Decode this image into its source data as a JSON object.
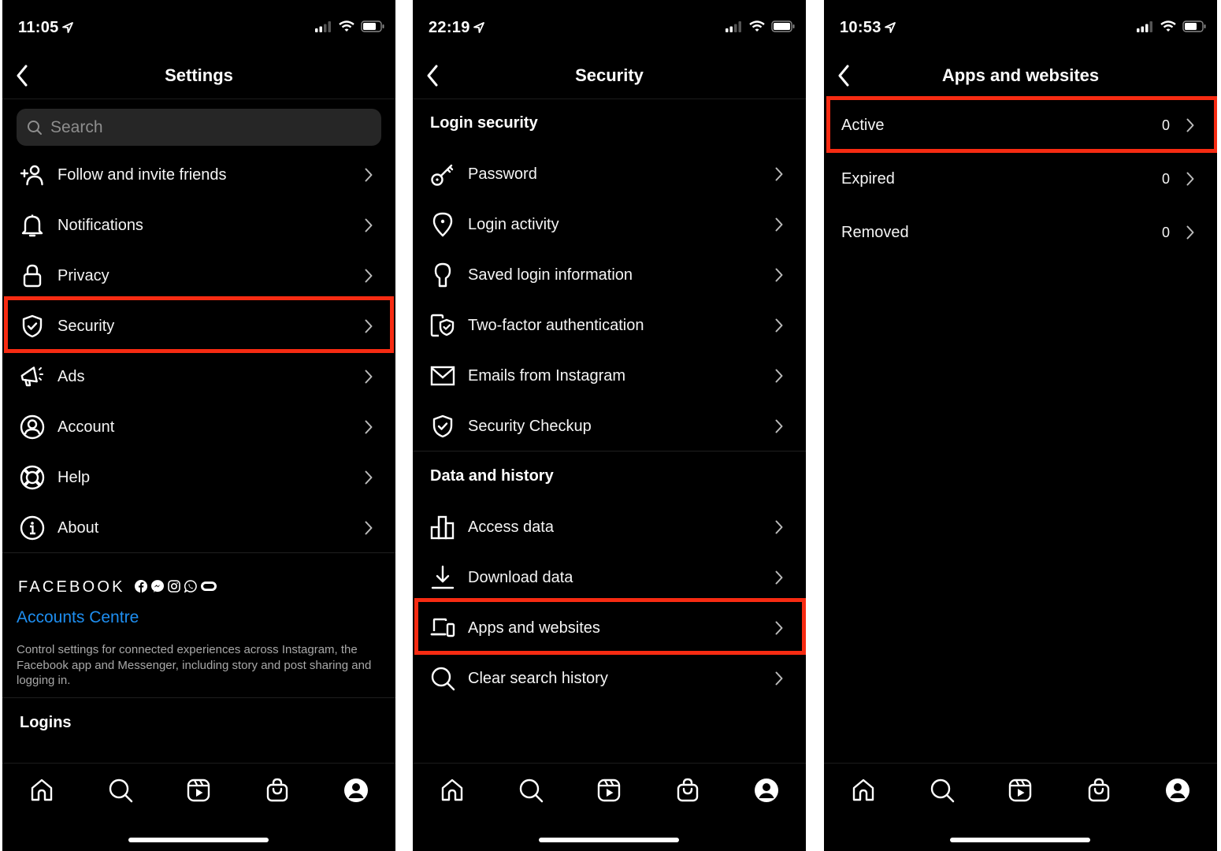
{
  "panels": [
    {
      "status": {
        "time": "11:05"
      },
      "title": "Settings",
      "search": {
        "placeholder": "Search"
      },
      "items": [
        {
          "label": "Follow and invite friends",
          "icon": "add-person-icon"
        },
        {
          "label": "Notifications",
          "icon": "bell-icon"
        },
        {
          "label": "Privacy",
          "icon": "lock-icon"
        },
        {
          "label": "Security",
          "icon": "shield-check-icon",
          "highlighted": true
        },
        {
          "label": "Ads",
          "icon": "megaphone-icon"
        },
        {
          "label": "Account",
          "icon": "account-circle-icon"
        },
        {
          "label": "Help",
          "icon": "lifebuoy-icon"
        },
        {
          "label": "About",
          "icon": "info-icon"
        }
      ],
      "facebook": {
        "brand": "FACEBOOK",
        "brand_icons": [
          "facebook-icon",
          "messenger-icon",
          "instagram-icon",
          "whatsapp-icon",
          "oculus-icon"
        ],
        "link": "Accounts Centre",
        "description": "Control settings for connected experiences across Instagram, the Facebook app and Messenger, including story and post sharing and logging in."
      },
      "logins_heading": "Logins"
    },
    {
      "status": {
        "time": "22:19"
      },
      "title": "Security",
      "sections": [
        {
          "heading": "Login security",
          "items": [
            {
              "label": "Password",
              "icon": "key-icon"
            },
            {
              "label": "Login activity",
              "icon": "location-pin-icon"
            },
            {
              "label": "Saved login information",
              "icon": "keyhole-icon"
            },
            {
              "label": "Two-factor authentication",
              "icon": "phone-shield-icon"
            },
            {
              "label": "Emails from Instagram",
              "icon": "envelope-icon"
            },
            {
              "label": "Security Checkup",
              "icon": "shield-check-icon"
            }
          ]
        },
        {
          "heading": "Data and history",
          "items": [
            {
              "label": "Access data",
              "icon": "bar-chart-icon"
            },
            {
              "label": "Download data",
              "icon": "download-icon"
            },
            {
              "label": "Apps and websites",
              "icon": "devices-icon",
              "highlighted": true
            },
            {
              "label": "Clear search history",
              "icon": "search-icon"
            }
          ]
        }
      ]
    },
    {
      "status": {
        "time": "10:53"
      },
      "title": "Apps and websites",
      "items": [
        {
          "label": "Active",
          "count": "0",
          "highlighted": true
        },
        {
          "label": "Expired",
          "count": "0"
        },
        {
          "label": "Removed",
          "count": "0"
        }
      ]
    }
  ],
  "tab_bar": [
    "home-icon",
    "search-icon",
    "reels-icon",
    "shop-icon",
    "profile-icon"
  ],
  "colors": {
    "highlight": "#f72b12",
    "link": "#1e8ef0",
    "background": "#000000"
  }
}
